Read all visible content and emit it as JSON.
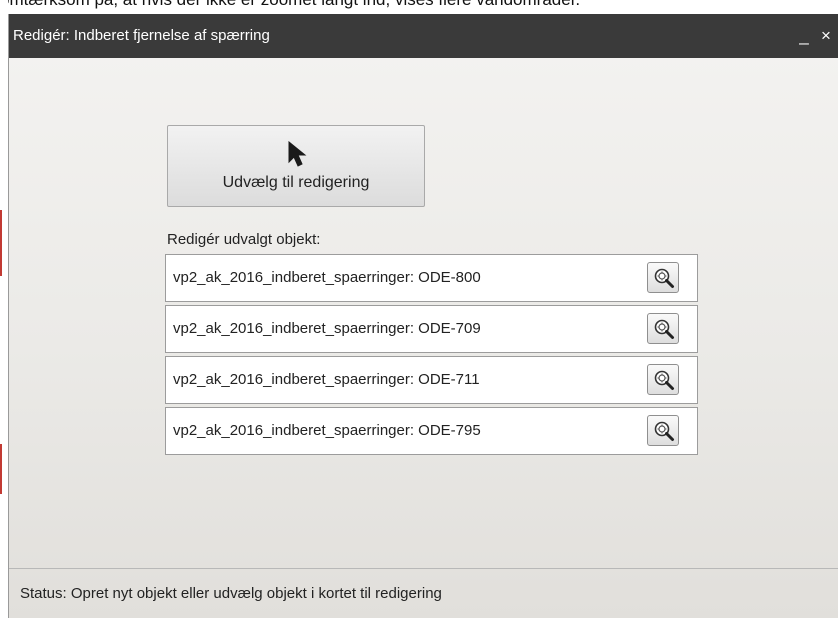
{
  "background": {
    "partial_text": "omtærksom på, at hvis der ikke er zoomet langt ind, vises flere vandområder."
  },
  "dialog": {
    "title": "Redigér: Indberet fjernelse af spærring",
    "minimize_label": "_",
    "close_label": "×",
    "select_button_label": "Udvælg til redigering",
    "select_button_icon": "cursor-arrow-icon",
    "section_label": "Redigér udvalgt objekt:",
    "objects": [
      {
        "label": "vp2_ak_2016_indberet_spaerringer: ODE-800",
        "icon": "zoom-to-icon"
      },
      {
        "label": "vp2_ak_2016_indberet_spaerringer: ODE-709",
        "icon": "zoom-to-icon"
      },
      {
        "label": "vp2_ak_2016_indberet_spaerringer: ODE-711",
        "icon": "zoom-to-icon"
      },
      {
        "label": "vp2_ak_2016_indberet_spaerringer: ODE-795",
        "icon": "zoom-to-icon"
      }
    ],
    "status": "Status: Opret nyt objekt eller udvælg objekt i kortet til redigering"
  },
  "colors": {
    "titlebar": "#3a3a3a",
    "titlebar_text": "#ffffff",
    "map_edge_red": "#c23a33"
  }
}
